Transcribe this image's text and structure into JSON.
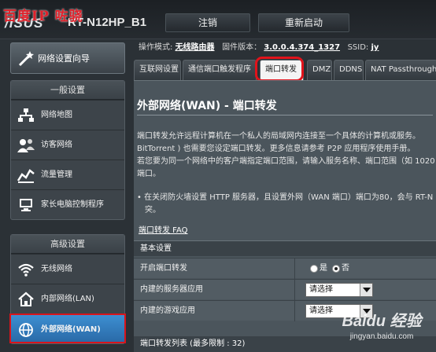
{
  "header": {
    "logo": "/ISUS",
    "model": "RT-N12HP_B1",
    "watermark": "百度IP 咗骁",
    "logout_label": "注销",
    "reboot_label": "重新启动"
  },
  "sidebar": {
    "wizard_label": "网络设置向导",
    "general_heading": "一般设置",
    "general_items": [
      {
        "label": "网络地图",
        "icon": "network-map-icon"
      },
      {
        "label": "访客网络",
        "icon": "guest-network-icon"
      },
      {
        "label": "流量管理",
        "icon": "traffic-manager-icon"
      },
      {
        "label": "家长电脑控制程序",
        "icon": "parental-control-icon"
      }
    ],
    "advanced_heading": "高级设置",
    "advanced_items": [
      {
        "label": "无线网络",
        "icon": "wireless-icon"
      },
      {
        "label": "内部网络(LAN)",
        "icon": "lan-icon"
      },
      {
        "label": "外部网络(WAN)",
        "icon": "wan-globe-icon",
        "active": true
      }
    ]
  },
  "status": {
    "mode_label": "操作模式:",
    "mode_value": "无线路由器",
    "firmware_label": "固件版本：",
    "firmware_value": "3.0.0.4.374_1327",
    "ssid_label": "SSID:",
    "ssid_value": "jy"
  },
  "tabs": [
    {
      "label": "互联网设置"
    },
    {
      "label": "通信端口触发程序"
    },
    {
      "label": "端口转发",
      "active": true
    },
    {
      "label": "DMZ"
    },
    {
      "label": "DDNS"
    },
    {
      "label": "NAT Passthrough"
    }
  ],
  "content": {
    "title": "外部网络(WAN) - 端口转发",
    "desc_line1": "端口转发允许远程计算机在一个私人的局域网内连接至一个具体的计算机或服务。",
    "desc_line2": "BitTorrent ) 也需要您设定端口转发。更多信息请参考 P2P 应用程序使用手册。",
    "desc_line3": "若您要为同一个网络中的客户端指定端口范围，请输入服务名称、端口范围（如 1020",
    "desc_line4": "端口。",
    "bullet_line1": "• 在关闭防火墙设置 HTTP 服务器，且设置外网（WAN 端口）端口为80，会与 RT-N",
    "bullet_line2": "突。",
    "faq_link": "端口转发 FAQ",
    "basic_heading": "基本设置",
    "enable_label": "开启端口转发",
    "yes_label": "是",
    "no_label": "否",
    "enable_value": "否",
    "server_label": "内建的服务器应用",
    "server_select": "请选择",
    "game_label": "内建的游戏应用",
    "game_select": "请选择",
    "list_heading": "端口转发列表 (最多限制 : 32)"
  },
  "watermark_bottom": {
    "brand": "Baidu 经验",
    "url": "jingyan.baidu.com"
  },
  "colors": {
    "accent_blue": "#2a6aa8",
    "highlight_red": "#e1131b",
    "panel": "#4b555c"
  }
}
